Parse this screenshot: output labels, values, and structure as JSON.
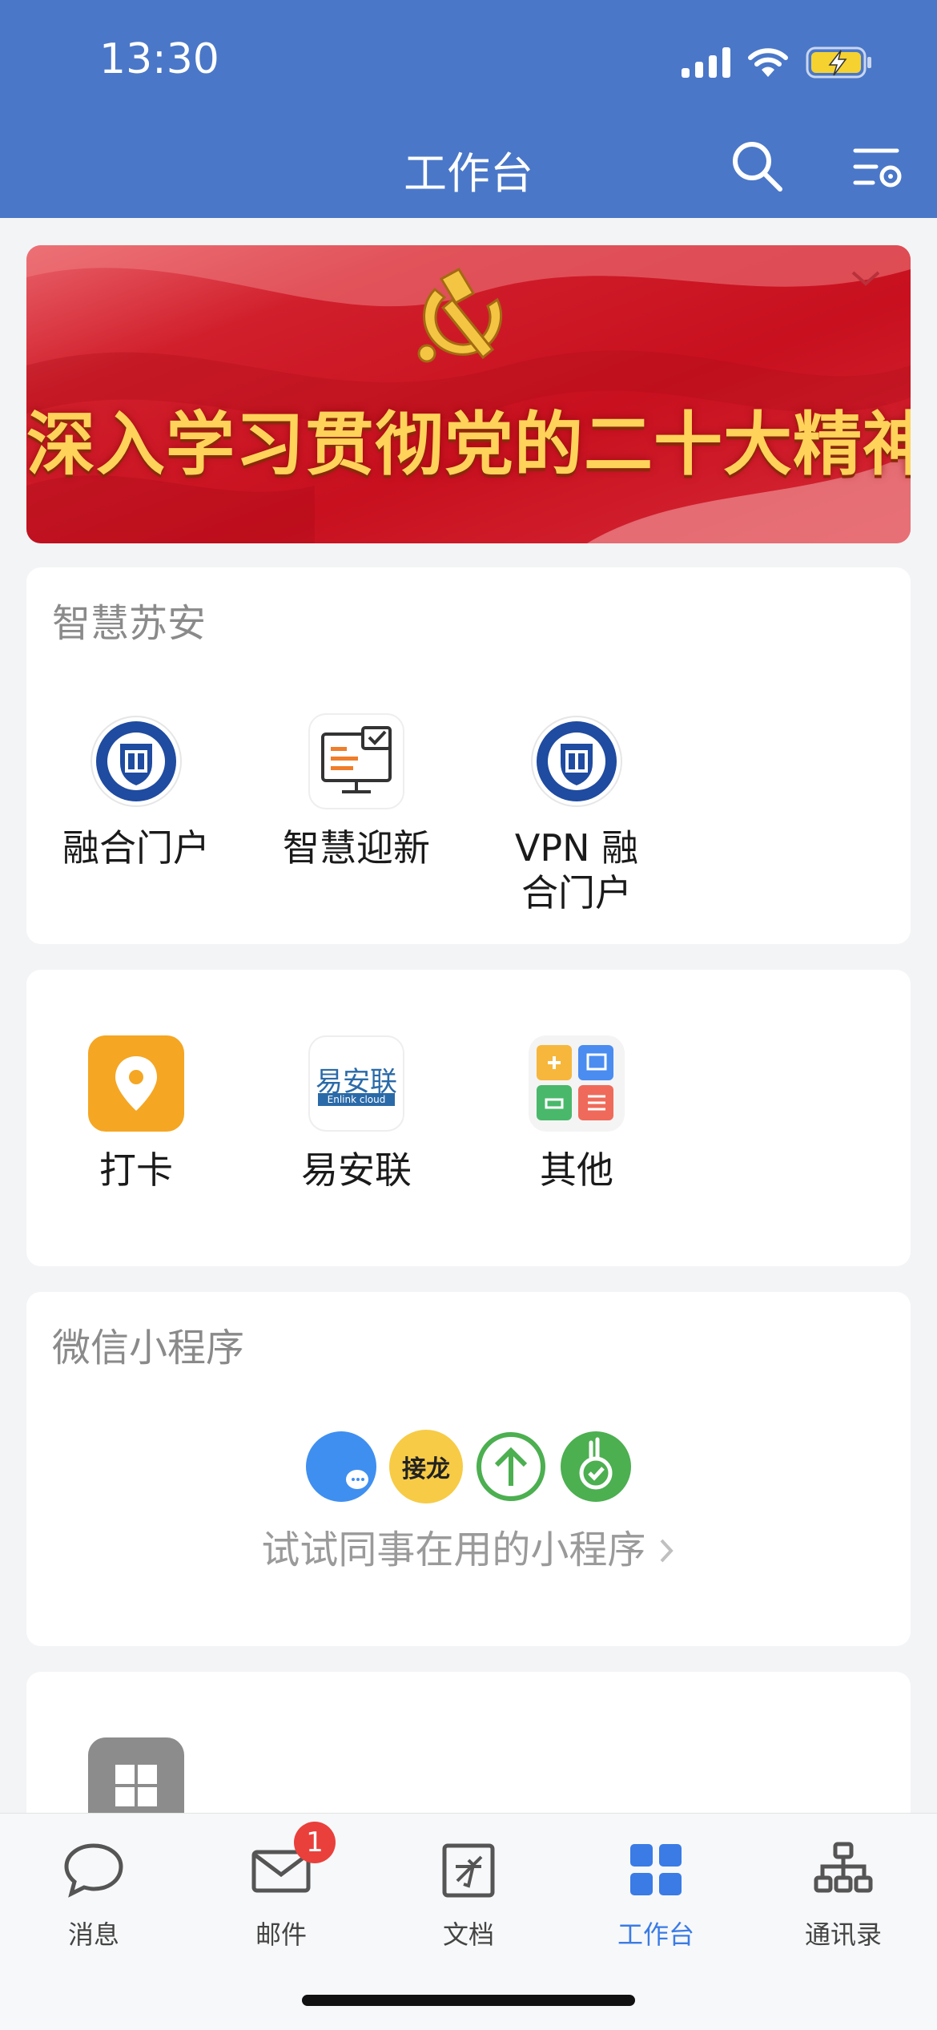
{
  "status_bar": {
    "time": "13:30"
  },
  "nav": {
    "title": "工作台"
  },
  "banner": {
    "text": "深入学习贯彻党的二十大精神"
  },
  "section_smart": {
    "title": "智慧苏安",
    "apps": [
      {
        "label": "融合门户",
        "icon": "school-emblem-icon"
      },
      {
        "label": "智慧迎新",
        "icon": "computer-screen-icon"
      },
      {
        "label": "VPN 融合门户",
        "icon": "school-emblem-icon"
      }
    ]
  },
  "section_tools": {
    "apps": [
      {
        "label": "打卡",
        "icon": "location-pin-icon",
        "color": "#f5a623"
      },
      {
        "label": "易安联",
        "icon": "enlink-logo-icon",
        "logo_text": "易安联",
        "logo_sub": "Enlink cloud"
      },
      {
        "label": "其他",
        "icon": "app-grid-icon"
      }
    ]
  },
  "section_miniprogram": {
    "title": "微信小程序",
    "icons": [
      {
        "name": "chat-bubble-icon",
        "color": "#3f8ff0"
      },
      {
        "name": "jielong-icon",
        "text": "接龙",
        "color": "#f7cb45"
      },
      {
        "name": "up-arrow-icon",
        "color": "#4caf50"
      },
      {
        "name": "hand-check-icon",
        "color": "#4caf50"
      }
    ],
    "hint": "试试同事在用的小程序"
  },
  "tabbar": {
    "items": [
      {
        "label": "消息",
        "icon": "chat-icon"
      },
      {
        "label": "邮件",
        "icon": "mail-icon",
        "badge": "1"
      },
      {
        "label": "文档",
        "icon": "document-icon"
      },
      {
        "label": "工作台",
        "icon": "workbench-grid-icon",
        "active": true
      },
      {
        "label": "通讯录",
        "icon": "contacts-org-icon"
      }
    ],
    "active_color": "#3a7be6"
  },
  "colors": {
    "header_bg": "#4a77c8",
    "page_bg": "#f3f4f6"
  }
}
